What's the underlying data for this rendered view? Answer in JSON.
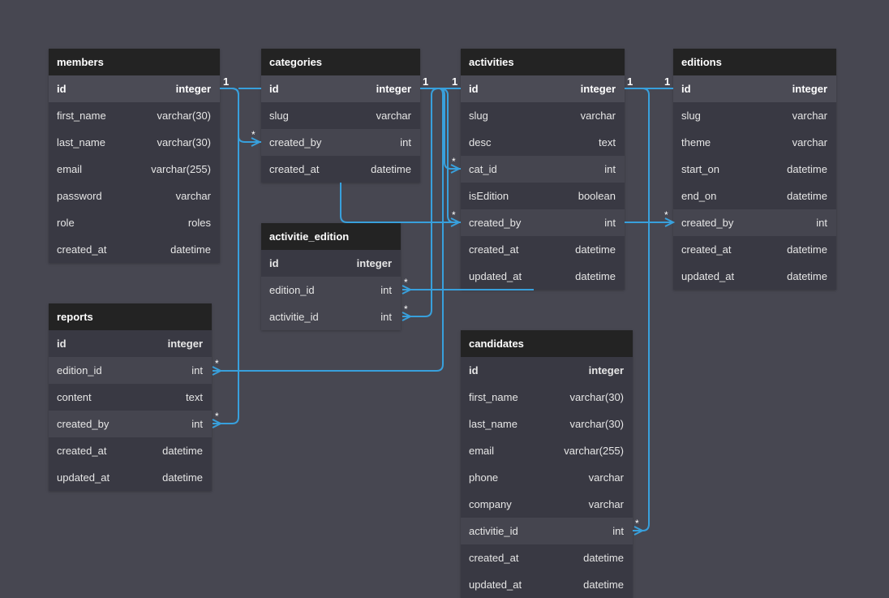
{
  "tables": {
    "members": {
      "name": "members",
      "fields": [
        {
          "name": "id",
          "type": "integer"
        },
        {
          "name": "first_name",
          "type": "varchar(30)"
        },
        {
          "name": "last_name",
          "type": "varchar(30)"
        },
        {
          "name": "email",
          "type": "varchar(255)"
        },
        {
          "name": "password",
          "type": "varchar"
        },
        {
          "name": "role",
          "type": "roles"
        },
        {
          "name": "created_at",
          "type": "datetime"
        }
      ]
    },
    "categories": {
      "name": "categories",
      "fields": [
        {
          "name": "id",
          "type": "integer"
        },
        {
          "name": "slug",
          "type": "varchar"
        },
        {
          "name": "created_by",
          "type": "int"
        },
        {
          "name": "created_at",
          "type": "datetime"
        }
      ]
    },
    "activities": {
      "name": "activities",
      "fields": [
        {
          "name": "id",
          "type": "integer"
        },
        {
          "name": "slug",
          "type": "varchar"
        },
        {
          "name": "desc",
          "type": "text"
        },
        {
          "name": "cat_id",
          "type": "int"
        },
        {
          "name": "isEdition",
          "type": "boolean"
        },
        {
          "name": "created_by",
          "type": "int"
        },
        {
          "name": "created_at",
          "type": "datetime"
        },
        {
          "name": "updated_at",
          "type": "datetime"
        }
      ]
    },
    "editions": {
      "name": "editions",
      "fields": [
        {
          "name": "id",
          "type": "integer"
        },
        {
          "name": "slug",
          "type": "varchar"
        },
        {
          "name": "theme",
          "type": "varchar"
        },
        {
          "name": "start_on",
          "type": "datetime"
        },
        {
          "name": "end_on",
          "type": "datetime"
        },
        {
          "name": "created_by",
          "type": "int"
        },
        {
          "name": "created_at",
          "type": "datetime"
        },
        {
          "name": "updated_at",
          "type": "datetime"
        }
      ]
    },
    "activitie_edition": {
      "name": "activitie_edition",
      "fields": [
        {
          "name": "id",
          "type": "integer"
        },
        {
          "name": "edition_id",
          "type": "int"
        },
        {
          "name": "activitie_id",
          "type": "int"
        }
      ]
    },
    "reports": {
      "name": "reports",
      "fields": [
        {
          "name": "id",
          "type": "integer"
        },
        {
          "name": "edition_id",
          "type": "int"
        },
        {
          "name": "content",
          "type": "text"
        },
        {
          "name": "created_by",
          "type": "int"
        },
        {
          "name": "created_at",
          "type": "datetime"
        },
        {
          "name": "updated_at",
          "type": "datetime"
        }
      ]
    },
    "candidates": {
      "name": "candidates",
      "fields": [
        {
          "name": "id",
          "type": "integer"
        },
        {
          "name": "first_name",
          "type": "varchar(30)"
        },
        {
          "name": "last_name",
          "type": "varchar(30)"
        },
        {
          "name": "email",
          "type": "varchar(255)"
        },
        {
          "name": "phone",
          "type": "varchar"
        },
        {
          "name": "company",
          "type": "varchar"
        },
        {
          "name": "activitie_id",
          "type": "int"
        },
        {
          "name": "created_at",
          "type": "datetime"
        },
        {
          "name": "updated_at",
          "type": "datetime"
        }
      ]
    }
  },
  "relations": {
    "one": "1",
    "many": "*"
  },
  "colors": {
    "background": "#474751",
    "header": "#232323",
    "row": "#393943",
    "row_alt": "#45454f",
    "connector": "#38a0dc"
  }
}
